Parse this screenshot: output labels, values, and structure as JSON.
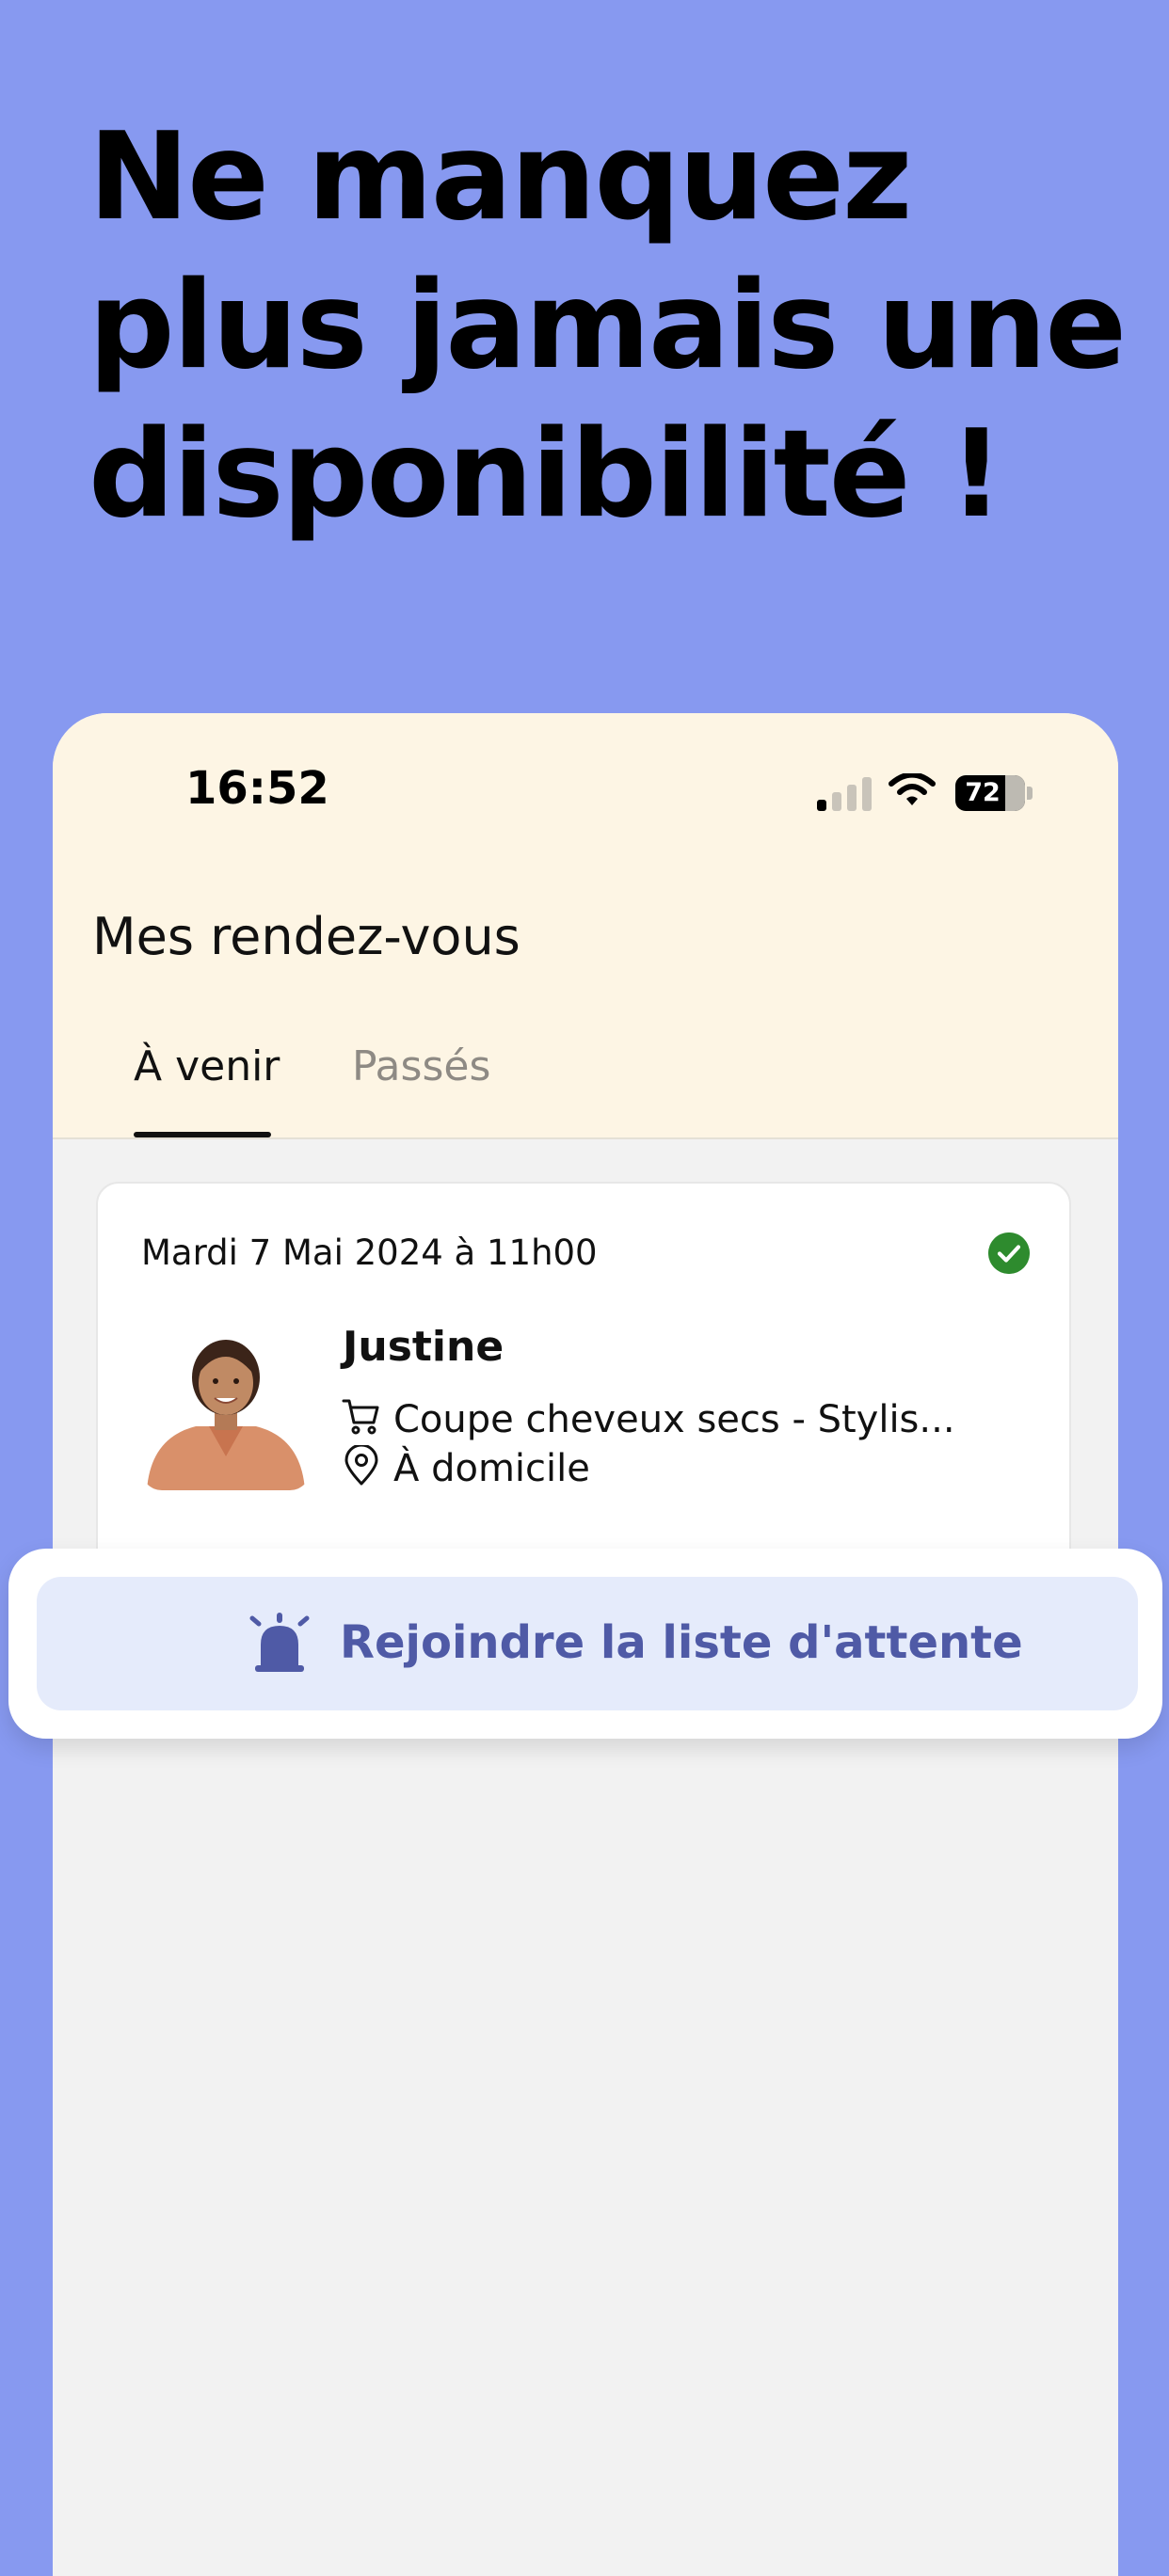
{
  "headline": {
    "lines": [
      "Ne manquez",
      "plus jamais une",
      "disponibilité !"
    ]
  },
  "status_bar": {
    "time": "16:52",
    "battery": "72",
    "battery_level": 0.72
  },
  "screen": {
    "title": "Mes rendez-vous",
    "tabs": [
      {
        "label": "À venir",
        "active": true
      },
      {
        "label": "Passés",
        "active": false
      }
    ]
  },
  "appointment": {
    "date": "Mardi 7 Mai 2024 à 11h00",
    "status": "confirmed",
    "provider_name": "Justine",
    "service": "Coupe cheveux secs - Stylis...",
    "location": "À domicile"
  },
  "waitlist": {
    "button_label": "Rejoindre la liste d'attente"
  },
  "colors": {
    "background": "#8799F0",
    "header_background": "#FDF5E4",
    "content_background": "#F2F2F2",
    "confirm_green": "#2E8B2E",
    "button_background": "#E5EBFB",
    "button_text": "#4F5AA6"
  },
  "icons": {
    "service": "cart-icon",
    "location": "map-pin-icon",
    "status": "check-circle-icon",
    "waitlist": "alarm-bell-icon"
  }
}
